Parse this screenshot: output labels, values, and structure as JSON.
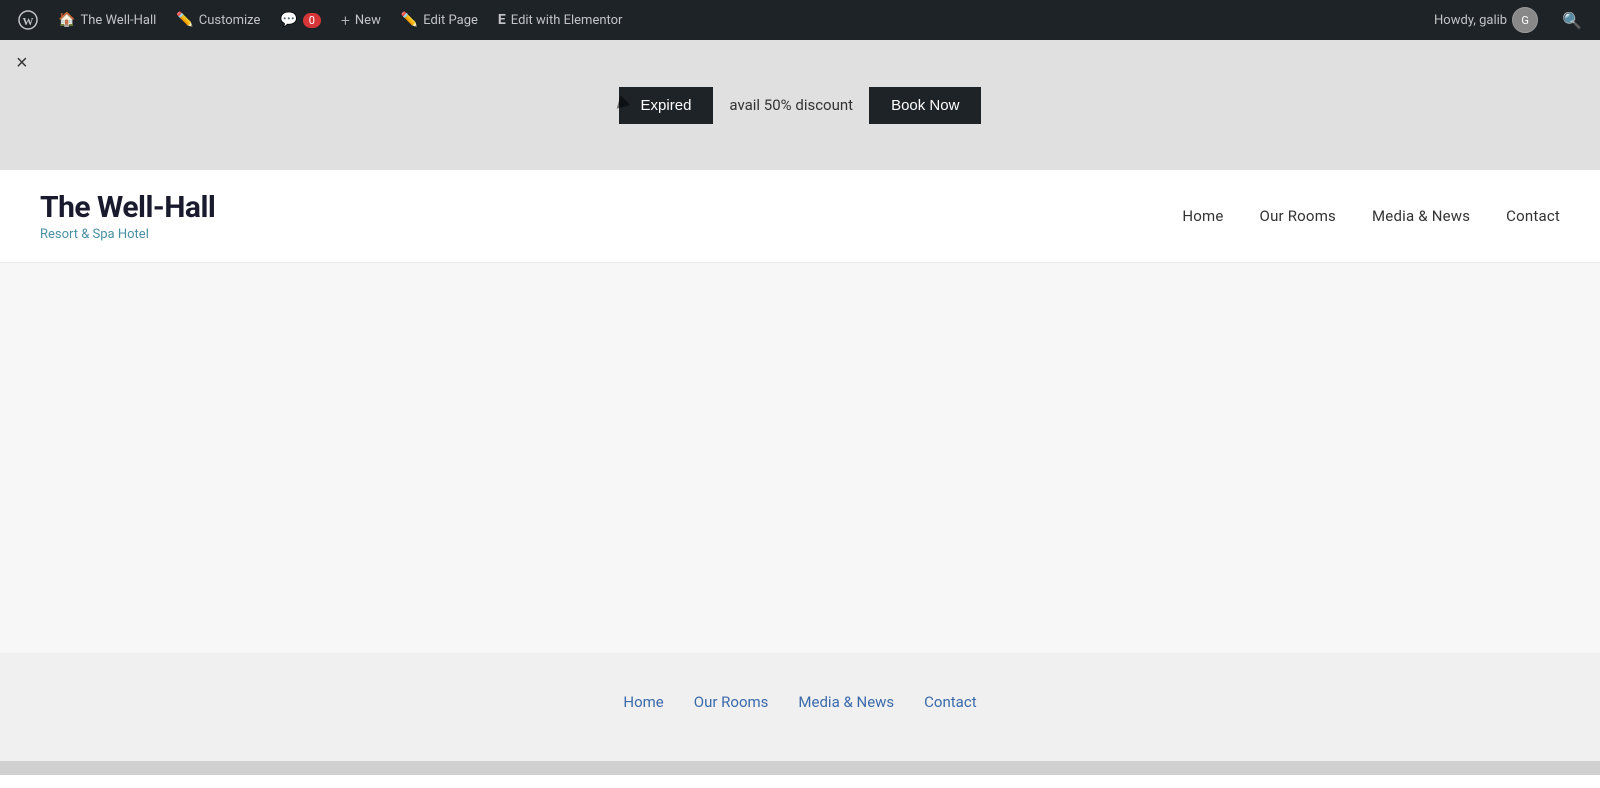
{
  "admin_bar": {
    "wp_logo_title": "About WordPress",
    "site_name": "The Well-Hall",
    "customize_label": "Customize",
    "comments_label": "0",
    "new_label": "New",
    "edit_page_label": "Edit Page",
    "edit_elementor_label": "Edit with Elementor",
    "howdy_label": "Howdy, galib",
    "search_icon": "search"
  },
  "notification_bar": {
    "close_label": "×",
    "expired_label": "Expired",
    "discount_text": "avail 50% discount",
    "book_now_label": "Book Now"
  },
  "site_header": {
    "site_title": "The Well-Hall",
    "site_tagline": "Resort & Spa Hotel",
    "nav_items": [
      {
        "label": "Home",
        "href": "#"
      },
      {
        "label": "Our Rooms",
        "href": "#"
      },
      {
        "label": "Media & News",
        "href": "#"
      },
      {
        "label": "Contact",
        "href": "#"
      }
    ]
  },
  "footer": {
    "nav_items": [
      {
        "label": "Home",
        "href": "#"
      },
      {
        "label": "Our Rooms",
        "href": "#"
      },
      {
        "label": "Media & News",
        "href": "#"
      },
      {
        "label": "Contact",
        "href": "#"
      }
    ]
  }
}
